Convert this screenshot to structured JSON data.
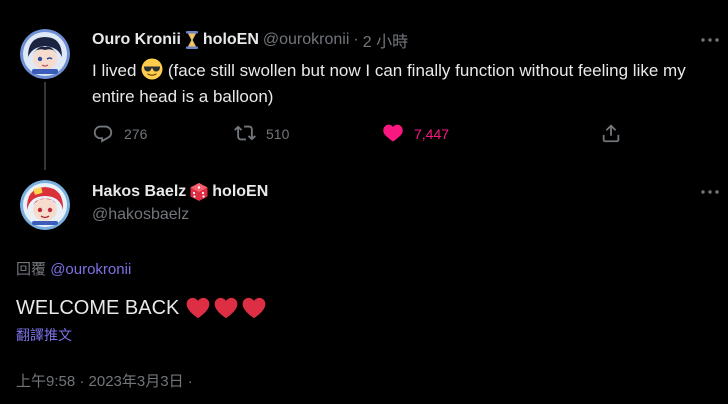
{
  "tweet1": {
    "display_name": "Ouro Kronii",
    "name_badge_icon": "hourglass-icon",
    "name_suffix": "holoEN",
    "handle": "@ourokronii",
    "separator": "·",
    "time": "2 小時",
    "text_before_emoji": "I lived",
    "emoji": "smiling-face-with-sunglasses",
    "text_after_emoji": "(face still swollen but now I can finally function without feeling like my entire head is a balloon)",
    "replies": "276",
    "retweets": "510",
    "likes": "7,447",
    "liked": true
  },
  "tweet2": {
    "display_name": "Hakos Baelz",
    "name_badge_icon": "red-dice-icon",
    "name_suffix": "holoEN",
    "handle": "@hakosbaelz",
    "reply_prefix": "回覆",
    "reply_to": "@ourokronii",
    "text": "WELCOME BACK",
    "emoji": "red-heart x3",
    "translate_label": "翻譯推文",
    "timestamp": "上午9:58 · 2023年3月3日 ·"
  },
  "colors": {
    "background": "#000000",
    "text_primary": "#e7e9ea",
    "text_secondary": "#71767b",
    "like_pink": "#f91880",
    "link_purple": "#7b71e5",
    "thread_line": "#333639"
  }
}
